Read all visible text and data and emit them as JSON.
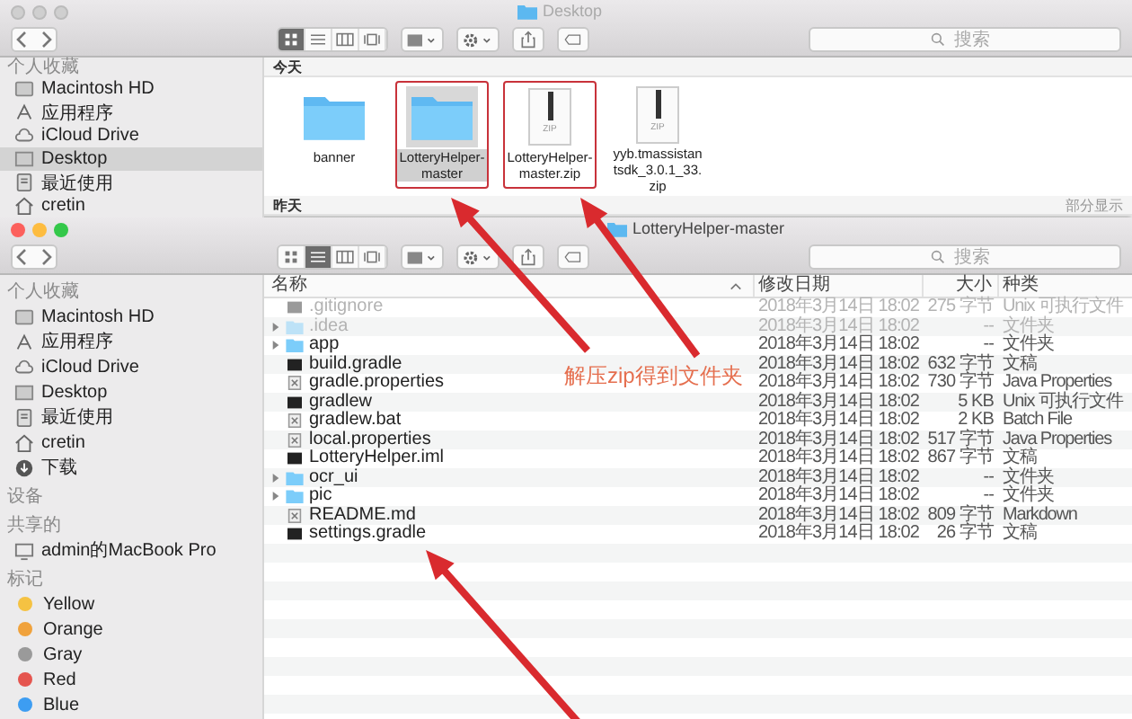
{
  "windows": [
    {
      "active": false,
      "title": "Desktop",
      "search_placeholder": "搜索",
      "view_modes": [
        {
          "kind": "icons",
          "selected": true
        },
        {
          "kind": "list",
          "selected": false
        },
        {
          "kind": "columns",
          "selected": false
        },
        {
          "kind": "gallery",
          "selected": false
        }
      ],
      "sidebar": [
        {
          "heading": "个人收藏",
          "items": [
            {
              "label": "Macintosh HD",
              "kind": "disk",
              "selected": false
            },
            {
              "label": "应用程序",
              "kind": "apps",
              "selected": false
            },
            {
              "label": "iCloud Drive",
              "kind": "cloud",
              "selected": false
            },
            {
              "label": "Desktop",
              "kind": "desktop",
              "selected": true
            },
            {
              "label": "最近使用",
              "kind": "recent",
              "selected": false
            },
            {
              "label": "cretin",
              "kind": "home",
              "selected": false
            }
          ]
        }
      ],
      "groups": [
        {
          "heading": "今天",
          "items": [
            {
              "name": "banner",
              "kind": "folder",
              "selected": false,
              "highlighted": false
            },
            {
              "name": "LotteryHelper-master",
              "kind": "folder",
              "selected": true,
              "highlighted": true
            },
            {
              "name": "LotteryHelper-master.zip",
              "kind": "zip",
              "icon_label": "ZIP",
              "selected": false,
              "highlighted": true
            },
            {
              "name": "yyb.tmassistantsdk_3.0.1_33.zip",
              "kind": "zip",
              "icon_label": "ZIP",
              "selected": false,
              "highlighted": false
            }
          ]
        },
        {
          "heading": "昨天",
          "action": "部分显示"
        }
      ]
    },
    {
      "active": true,
      "title": "LotteryHelper-master",
      "search_placeholder": "搜索",
      "view_modes": [
        {
          "kind": "icons",
          "selected": false
        },
        {
          "kind": "list",
          "selected": true
        },
        {
          "kind": "columns",
          "selected": false
        },
        {
          "kind": "gallery",
          "selected": false
        }
      ],
      "sidebar": [
        {
          "heading": "个人收藏",
          "items": [
            {
              "label": "Macintosh HD",
              "kind": "disk",
              "selected": false
            },
            {
              "label": "应用程序",
              "kind": "apps",
              "selected": false
            },
            {
              "label": "iCloud Drive",
              "kind": "cloud",
              "selected": false
            },
            {
              "label": "Desktop",
              "kind": "desktop",
              "selected": false
            },
            {
              "label": "最近使用",
              "kind": "recent",
              "selected": false
            },
            {
              "label": "cretin",
              "kind": "home",
              "selected": false
            },
            {
              "label": "下载",
              "kind": "download",
              "selected": false
            }
          ]
        },
        {
          "heading": "设备"
        },
        {
          "heading": "共享的",
          "items": [
            {
              "label": "admin的MacBook Pro",
              "kind": "computer",
              "selected": false
            }
          ]
        },
        {
          "heading": "标记",
          "items": [
            {
              "label": "Yellow",
              "kind": "tag",
              "color": "#f5c242",
              "selected": false
            },
            {
              "label": "Orange",
              "kind": "tag",
              "color": "#f0a23c",
              "selected": false
            },
            {
              "label": "Gray",
              "kind": "tag",
              "color": "#9a9a9a",
              "selected": false
            },
            {
              "label": "Red",
              "kind": "tag",
              "color": "#e5554f",
              "selected": false
            },
            {
              "label": "Blue",
              "kind": "tag",
              "color": "#3d9df2",
              "selected": false
            }
          ]
        }
      ],
      "columns": [
        "名称",
        "修改日期",
        "大小",
        "种类"
      ],
      "rows": [
        {
          "name": ".gitignore",
          "kind": "script",
          "hidden": true,
          "date": "2018年3月14日 18:02",
          "size": "275 字节",
          "type": "Unix 可执行文件"
        },
        {
          "name": ".idea",
          "kind": "folder",
          "hidden": true,
          "date": "2018年3月14日 18:02",
          "size": "--",
          "type": "文件夹"
        },
        {
          "name": "app",
          "kind": "folder",
          "hidden": false,
          "date": "2018年3月14日 18:02",
          "size": "--",
          "type": "文件夹"
        },
        {
          "name": "build.gradle",
          "kind": "script",
          "hidden": false,
          "date": "2018年3月14日 18:02",
          "size": "632 字节",
          "type": "文稿"
        },
        {
          "name": "gradle.properties",
          "kind": "text",
          "hidden": false,
          "date": "2018年3月14日 18:02",
          "size": "730 字节",
          "type": "Java Properties"
        },
        {
          "name": "gradlew",
          "kind": "script",
          "hidden": false,
          "date": "2018年3月14日 18:02",
          "size": "5 KB",
          "type": "Unix 可执行文件"
        },
        {
          "name": "gradlew.bat",
          "kind": "text",
          "hidden": false,
          "date": "2018年3月14日 18:02",
          "size": "2 KB",
          "type": "Batch File"
        },
        {
          "name": "local.properties",
          "kind": "text",
          "hidden": false,
          "date": "2018年3月14日 18:02",
          "size": "517 字节",
          "type": "Java Properties"
        },
        {
          "name": "LotteryHelper.iml",
          "kind": "script",
          "hidden": false,
          "date": "2018年3月14日 18:02",
          "size": "867 字节",
          "type": "文稿"
        },
        {
          "name": "ocr_ui",
          "kind": "folder",
          "hidden": false,
          "date": "2018年3月14日 18:02",
          "size": "--",
          "type": "文件夹"
        },
        {
          "name": "pic",
          "kind": "folder",
          "hidden": false,
          "date": "2018年3月14日 18:02",
          "size": "--",
          "type": "文件夹"
        },
        {
          "name": "README.md",
          "kind": "text",
          "hidden": false,
          "date": "2018年3月14日 18:02",
          "size": "809 字节",
          "type": "Markdown"
        },
        {
          "name": "settings.gradle",
          "kind": "script",
          "hidden": false,
          "date": "2018年3月14日 18:02",
          "size": "26 字节",
          "type": "文稿"
        }
      ]
    }
  ],
  "annotation": {
    "caption": "解压zip得到文件夹"
  }
}
